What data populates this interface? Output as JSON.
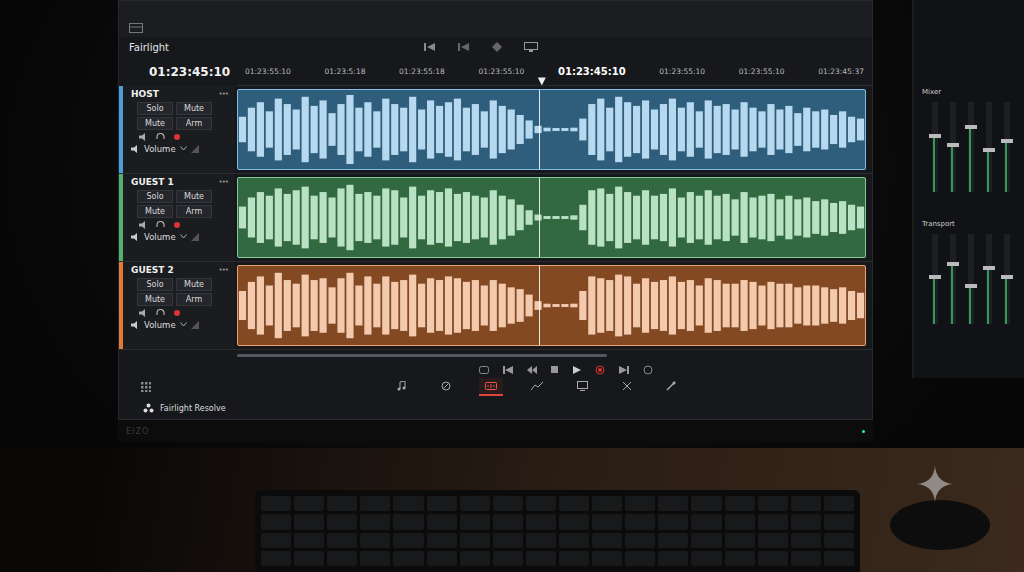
{
  "app": {
    "title": "Fairlight",
    "timecode": "01:23:45:10",
    "logo": "Fairlight Resolve",
    "brand": "EIZO"
  },
  "ruler": {
    "ticks": [
      {
        "label": "01:23:55:10",
        "current": false
      },
      {
        "label": "01:23:5:18",
        "current": false
      },
      {
        "label": "01:23:55:18",
        "current": false
      },
      {
        "label": "01:23:55:10",
        "current": false
      },
      {
        "label": "01:23:45:10",
        "current": true
      },
      {
        "label": "01:23:55:10",
        "current": false
      },
      {
        "label": "01:23:55:10",
        "current": false
      },
      {
        "label": "01:23:45:37",
        "current": false
      }
    ],
    "playhead": 0.48
  },
  "tracks": [
    {
      "name": "HOST",
      "menu": "•••",
      "color": "#4a9fd8",
      "buttons": [
        "Solo",
        "Mute",
        "Mute",
        "Arm"
      ],
      "fader": "Volume",
      "waveform": [
        0.35,
        0.6,
        0.75,
        0.5,
        0.85,
        0.7,
        0.55,
        0.9,
        0.65,
        0.8,
        0.45,
        0.7,
        0.95,
        0.6,
        0.75,
        0.5,
        0.85,
        0.7,
        0.6,
        0.9,
        0.55,
        0.8,
        0.65,
        0.75,
        0.85,
        0.6,
        0.7,
        0.5,
        0.8,
        0.65,
        0.55,
        0.4,
        0.25,
        0.1,
        0.05,
        0.04,
        0.04,
        0.05,
        0.3,
        0.7,
        0.85,
        0.6,
        0.9,
        0.75,
        0.65,
        0.8,
        0.55,
        0.7,
        0.85,
        0.6,
        0.75,
        0.5,
        0.8,
        0.65,
        0.7,
        0.55,
        0.75,
        0.6,
        0.5,
        0.7,
        0.55,
        0.65,
        0.45,
        0.6,
        0.5,
        0.55,
        0.4,
        0.5,
        0.35,
        0.3
      ]
    },
    {
      "name": "GUEST 1",
      "menu": "•••",
      "color": "#4fb36a",
      "buttons": [
        "Solo",
        "Mute",
        "Mute",
        "Arm"
      ],
      "fader": "Volume",
      "waveform": [
        0.3,
        0.55,
        0.7,
        0.6,
        0.8,
        0.65,
        0.75,
        0.85,
        0.6,
        0.7,
        0.55,
        0.8,
        0.9,
        0.65,
        0.7,
        0.6,
        0.8,
        0.75,
        0.55,
        0.85,
        0.6,
        0.75,
        0.7,
        0.8,
        0.65,
        0.7,
        0.6,
        0.55,
        0.75,
        0.6,
        0.5,
        0.35,
        0.2,
        0.08,
        0.04,
        0.04,
        0.04,
        0.06,
        0.35,
        0.75,
        0.8,
        0.65,
        0.85,
        0.7,
        0.6,
        0.75,
        0.6,
        0.65,
        0.8,
        0.55,
        0.7,
        0.6,
        0.75,
        0.6,
        0.65,
        0.5,
        0.7,
        0.55,
        0.6,
        0.65,
        0.5,
        0.6,
        0.5,
        0.55,
        0.45,
        0.5,
        0.4,
        0.45,
        0.35,
        0.3
      ]
    },
    {
      "name": "GUEST 2",
      "menu": "•••",
      "color": "#e07a35",
      "buttons": [
        "Solo",
        "Mute",
        "Mute",
        "Arm"
      ],
      "fader": "Volume",
      "waveform": [
        0.4,
        0.65,
        0.8,
        0.55,
        0.9,
        0.7,
        0.6,
        0.85,
        0.7,
        0.75,
        0.5,
        0.75,
        0.9,
        0.55,
        0.8,
        0.6,
        0.8,
        0.65,
        0.7,
        0.85,
        0.6,
        0.75,
        0.7,
        0.8,
        0.75,
        0.65,
        0.7,
        0.55,
        0.7,
        0.6,
        0.5,
        0.45,
        0.3,
        0.12,
        0.05,
        0.04,
        0.04,
        0.05,
        0.4,
        0.8,
        0.75,
        0.7,
        0.85,
        0.8,
        0.6,
        0.75,
        0.65,
        0.7,
        0.8,
        0.65,
        0.7,
        0.55,
        0.75,
        0.7,
        0.6,
        0.6,
        0.7,
        0.65,
        0.55,
        0.65,
        0.6,
        0.6,
        0.5,
        0.55,
        0.55,
        0.5,
        0.45,
        0.5,
        0.4,
        0.35
      ]
    }
  ],
  "pages": [
    {
      "kind": "music",
      "selected": false
    },
    {
      "kind": "edit",
      "selected": false
    },
    {
      "kind": "fairlight",
      "selected": true
    },
    {
      "kind": "curve",
      "selected": false
    },
    {
      "kind": "deliver",
      "selected": false
    },
    {
      "kind": "cut",
      "selected": false
    },
    {
      "kind": "color",
      "selected": false
    }
  ],
  "side_monitor": {
    "sections": [
      {
        "title": "Mixer",
        "faders": [
          0.6,
          0.5,
          0.7,
          0.45,
          0.55
        ]
      },
      {
        "title": "Transport",
        "faders": [
          0.5,
          0.65,
          0.4,
          0.6,
          0.5
        ]
      }
    ]
  }
}
